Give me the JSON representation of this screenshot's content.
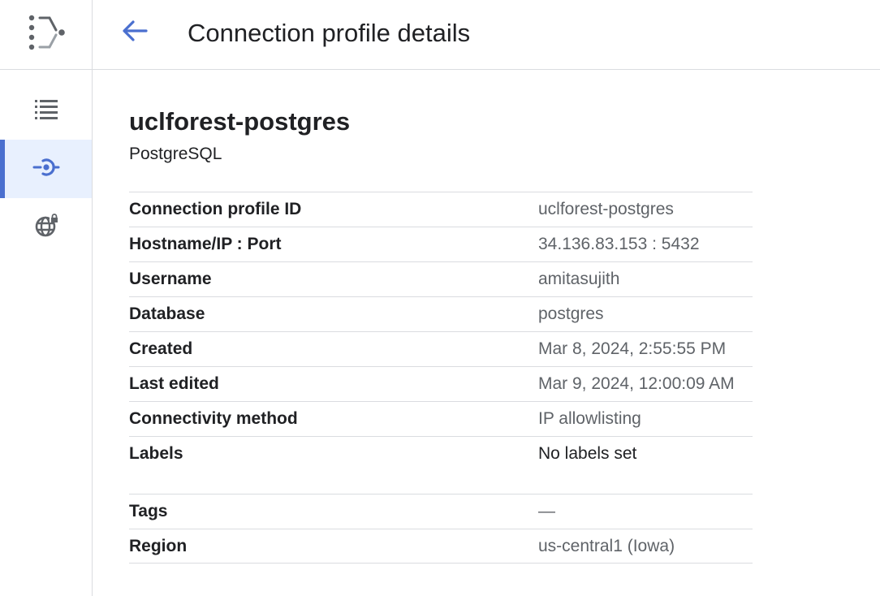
{
  "header": {
    "title": "Connection profile details",
    "back_icon": "arrow-back-icon"
  },
  "rail": {
    "logo_icon": "database-migration-logo-icon",
    "items": [
      {
        "icon": "list-icon",
        "active": false
      },
      {
        "icon": "connection-profile-icon",
        "active": true
      },
      {
        "icon": "private-connectivity-globe-icon",
        "active": false
      }
    ]
  },
  "profile": {
    "name": "uclforest-postgres",
    "type": "PostgreSQL"
  },
  "details": {
    "rows": [
      {
        "key": "Connection profile ID",
        "value": "uclforest-postgres"
      },
      {
        "key": "Hostname/IP : Port",
        "value": "34.136.83.153 : 5432"
      },
      {
        "key": "Username",
        "value": "amitasujith"
      },
      {
        "key": "Database",
        "value": "postgres"
      },
      {
        "key": "Created",
        "value": "Mar 8, 2024, 2:55:55 PM"
      },
      {
        "key": "Last edited",
        "value": "Mar 9, 2024, 12:00:09 AM"
      },
      {
        "key": "Connectivity method",
        "value": "IP allowlisting"
      },
      {
        "key": "Labels",
        "value": "No labels set"
      }
    ],
    "rows2": [
      {
        "key": "Tags",
        "value": "—"
      },
      {
        "key": "Region",
        "value": "us-central1 (Iowa)"
      }
    ]
  },
  "colors": {
    "accent": "#4a6fcf",
    "active_bg": "#e8f0fe",
    "divider": "#dadce0",
    "text_primary": "#202124",
    "text_secondary": "#5f6368"
  }
}
